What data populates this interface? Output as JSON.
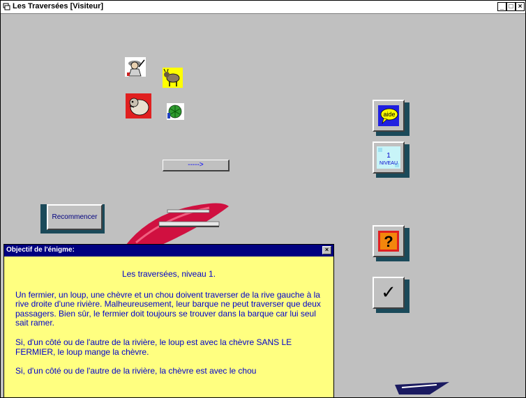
{
  "window": {
    "title": "Les Traversées [Visiteur]",
    "controls": {
      "minimize": "_",
      "maximize": "□",
      "close": "×"
    }
  },
  "game": {
    "pieces": [
      {
        "name": "farmer",
        "icon": "farmer-icon"
      },
      {
        "name": "goat",
        "icon": "goat-icon"
      },
      {
        "name": "wolf",
        "icon": "wolf-icon"
      },
      {
        "name": "cabbage",
        "icon": "cabbage-icon"
      }
    ],
    "cross_button_label": "----->",
    "restart_label": "Recommencer",
    "side_buttons": {
      "help_label": "aide",
      "level_number": "1",
      "level_label": "NIVEAU",
      "hint_label": "?",
      "validate_label": "✓"
    }
  },
  "dialog": {
    "title": "Objectif de l'énigme:",
    "close": "×",
    "heading": "Les traversées, niveau 1.",
    "paragraphs": [
      "Un fermier, un loup, une chèvre et un chou doivent traverser de la rive gauche à la rive droite d'une rivière. Malheureusement, leur barque ne peut traverser que deux passagers. Bien sûr, le fermier doit toujours se trouver dans la barque car lui seul sait ramer.",
      "Si, d'un côté ou de l'autre de la rivière, le loup est avec la chèvre SANS LE FERMIER, le loup mange la chèvre.",
      "Si, d'un côté ou de l'autre de la rivière, la chèvre est avec le chou"
    ]
  },
  "colors": {
    "background": "#c0c0c0",
    "dialog_bg": "#ffff80",
    "dialog_title_bg": "#000080",
    "text_blue": "#0000cc",
    "boat": "#d01040"
  }
}
